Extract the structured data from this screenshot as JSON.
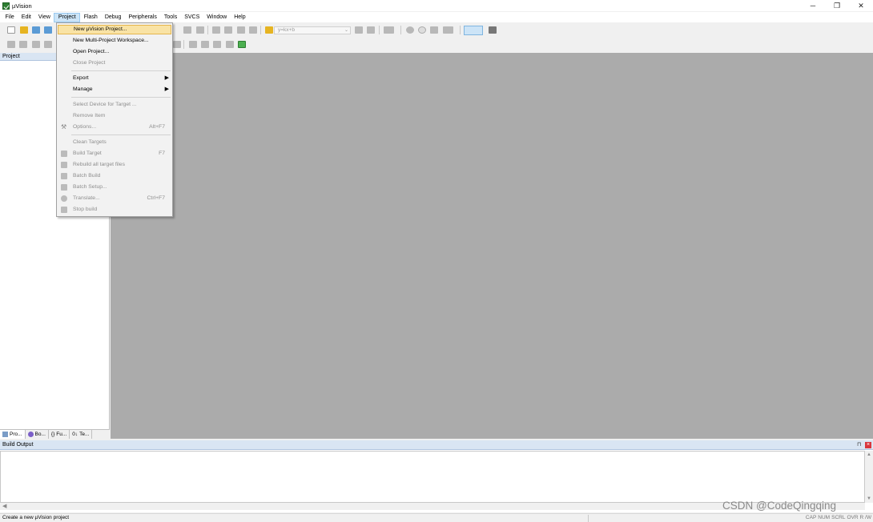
{
  "window": {
    "title": "µVision",
    "minimize_glyph": "─",
    "maximize_glyph": "❐",
    "close_glyph": "✕"
  },
  "menubar": [
    "File",
    "Edit",
    "View",
    "Project",
    "Flash",
    "Debug",
    "Peripherals",
    "Tools",
    "SVCS",
    "Window",
    "Help"
  ],
  "toolbar": {
    "target_value": "y=kx+b",
    "target_arrow": "⌄"
  },
  "project_pane": {
    "header": "Project",
    "tabs": [
      "Pro...",
      "Bo...",
      "Fu...",
      "Te..."
    ],
    "tab_icons": [
      "project-icon",
      "books-icon",
      "functions-icon",
      "templates-icon"
    ],
    "functions_glyph": "{}",
    "templates_glyph": "0↓"
  },
  "project_menu": {
    "items": [
      {
        "label": "New µVision Project...",
        "enabled": true,
        "highlighted": true
      },
      {
        "label": "New Multi-Project Workspace...",
        "enabled": true
      },
      {
        "label": "Open Project...",
        "enabled": true
      },
      {
        "label": "Close Project",
        "enabled": false
      },
      {
        "label": "Export",
        "enabled": true,
        "submenu": true
      },
      {
        "label": "Manage",
        "enabled": true,
        "submenu": true
      },
      {
        "label": "Select Device for Target ...",
        "enabled": false
      },
      {
        "label": "Remove Item",
        "enabled": false
      },
      {
        "label": "Options...",
        "enabled": false,
        "shortcut": "Alt+F7",
        "icon": "magic-wand-icon"
      },
      {
        "label": "Clean Targets",
        "enabled": false
      },
      {
        "label": "Build Target",
        "enabled": false,
        "shortcut": "F7",
        "icon": "build-icon"
      },
      {
        "label": "Rebuild all target files",
        "enabled": false,
        "icon": "rebuild-icon"
      },
      {
        "label": "Batch Build",
        "enabled": false,
        "icon": "batch-build-icon"
      },
      {
        "label": "Batch Setup...",
        "enabled": false,
        "icon": "batch-setup-icon"
      },
      {
        "label": "Translate...",
        "enabled": false,
        "shortcut": "Ctrl+F7",
        "icon": "translate-icon"
      },
      {
        "label": "Stop build",
        "enabled": false,
        "icon": "stop-build-icon"
      }
    ],
    "submenu_glyph": "▶",
    "wand_glyph": "⚒"
  },
  "build_output": {
    "header": "Build Output",
    "pin_glyph": "⊓",
    "close_glyph": "×",
    "scroll_up_glyph": "▲",
    "scroll_down_glyph": "▼",
    "scroll_left_glyph": "◀"
  },
  "statusbar": {
    "text": "Create a new µVision project",
    "indicators": [
      "CAP",
      "NUM",
      "SCRL",
      "OVR",
      "R /W"
    ]
  },
  "watermark": "CSDN @CodeQingqing",
  "colors": {
    "editor_background": "#ababab",
    "menu_highlight": "#f9e3a5",
    "pane_header": "#d9e5f3",
    "close_red": "#d9363e"
  }
}
